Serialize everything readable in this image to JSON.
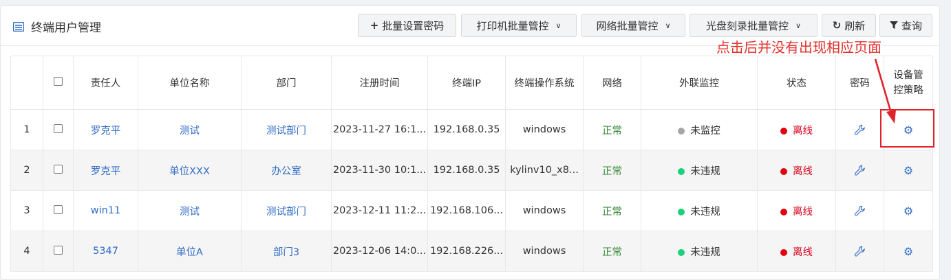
{
  "header": {
    "title": "终端用户管理",
    "buttons": {
      "batch_password": "批量设置密码",
      "printer": "打印机批量管控",
      "network": "网络批量管控",
      "disc": "光盘刻录批量管控",
      "refresh": "刷新",
      "query": "查询"
    }
  },
  "table": {
    "headers": {
      "owner": "责任人",
      "unit": "单位名称",
      "dept": "部门",
      "reg_time": "注册时间",
      "ip": "终端IP",
      "os": "终端操作系统",
      "network": "网络",
      "monitor": "外联监控",
      "status": "状态",
      "password": "密码",
      "policy": "设备管控策略"
    },
    "rows": [
      {
        "no": "1",
        "owner": "罗克平",
        "unit": "测试",
        "dept": "测试部门",
        "reg_time": "2023-11-27 16:1...",
        "ip": "192.168.0.35",
        "os": "windows",
        "network": "正常",
        "monitor": "未监控",
        "monitor_color": "#a6a6a6",
        "status": "离线"
      },
      {
        "no": "2",
        "owner": "罗克平",
        "unit": "单位XXX",
        "dept": "办公室",
        "reg_time": "2023-11-30 10:1...",
        "ip": "192.168.0.35",
        "os": "kylinv10_x8...",
        "network": "正常",
        "monitor": "未违规",
        "monitor_color": "#19d27a",
        "status": "离线"
      },
      {
        "no": "3",
        "owner": "win11",
        "unit": "测试",
        "dept": "测试部门",
        "reg_time": "2023-12-11 11:2...",
        "ip": "192.168.106...",
        "os": "windows",
        "network": "正常",
        "monitor": "未违规",
        "monitor_color": "#19d27a",
        "status": "离线"
      },
      {
        "no": "4",
        "owner": "5347",
        "unit": "单位A",
        "dept": "部门3",
        "reg_time": "2023-12-06 14:0...",
        "ip": "192.168.226...",
        "os": "windows",
        "network": "正常",
        "monitor": "未违规",
        "monitor_color": "#19d27a",
        "status": "离线"
      }
    ]
  },
  "annotation": {
    "text": "点击后并没有出现相应页面",
    "color": "#e5322d"
  },
  "colors": {
    "link": "#2f6bc6",
    "ok": "#3a8a3a",
    "offline": "#d9001b"
  },
  "icons": {
    "title": "list-icon",
    "batch_password": "plus-icon",
    "refresh": "refresh-icon",
    "query": "filter-icon",
    "password": "wrench-icon",
    "policy": "gear-icon",
    "status": "red-dot"
  }
}
